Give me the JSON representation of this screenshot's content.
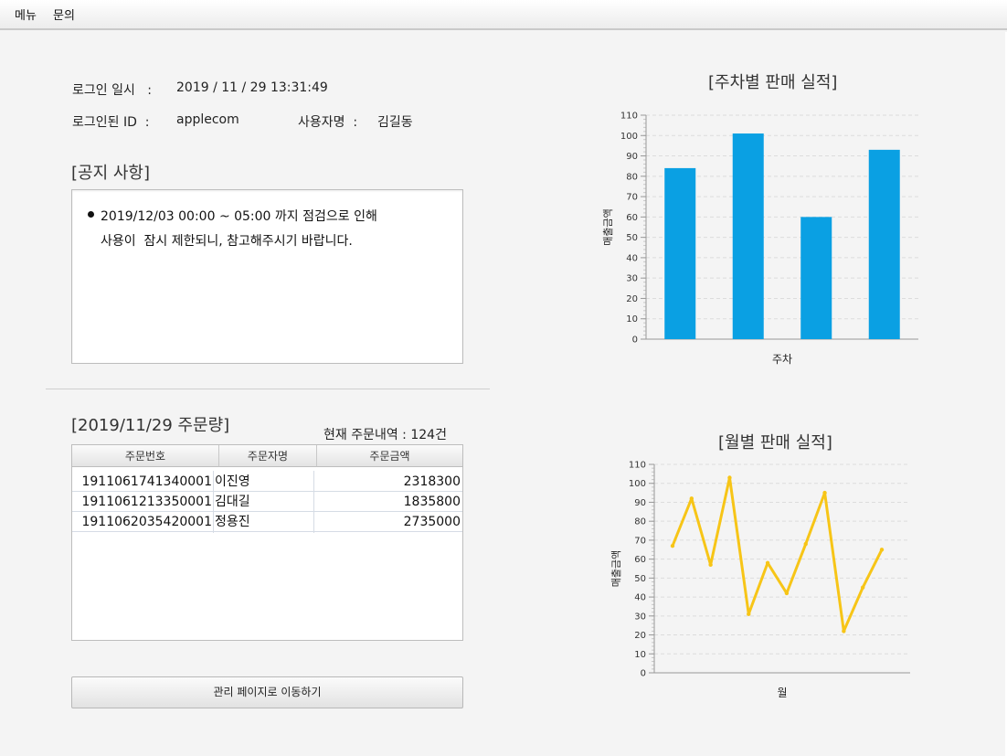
{
  "menu": {
    "items": [
      "메뉴",
      "문의"
    ]
  },
  "login": {
    "time_label": "로그인 일시   :",
    "time_value": "2019 / 11 / 29 13:31:49",
    "id_label": "로그인된 ID  :",
    "id_value": "applecom",
    "user_label": "사용자명  :",
    "user_value": "김길동"
  },
  "notice": {
    "title": "[공지 사항]",
    "lines": [
      "2019/12/03 00:00 ~ 05:00 까지 점검으로 인해",
      "사용이  잠시 제한되니, 참고해주시기 바랍니다."
    ]
  },
  "orders": {
    "title": "[2019/11/29 주문량]",
    "count_text": "현재 주문내역 : 124건",
    "headers": [
      "주문번호",
      "주문자명",
      "주문금액"
    ],
    "rows": [
      [
        "1911061741340001",
        "이진영",
        "2318300"
      ],
      [
        "1911061213350001",
        "김대길",
        "1835800"
      ],
      [
        "1911062035420001",
        "정용진",
        "2735000"
      ]
    ]
  },
  "admin_button": "관리 페이지로 이동하기",
  "chart_data": [
    {
      "type": "bar",
      "title": "[주차별 판매 실적]",
      "xlabel": "주차",
      "ylabel": "매출금액",
      "categories": [
        "",
        "",
        "",
        ""
      ],
      "values": [
        84,
        101,
        60,
        93
      ],
      "ylim": [
        0,
        110
      ],
      "yticks": [
        0,
        10,
        20,
        30,
        40,
        50,
        60,
        70,
        80,
        90,
        100,
        110
      ],
      "grid": true,
      "color": "#0aa0e3"
    },
    {
      "type": "line",
      "title": "[월별 판매 실적]",
      "xlabel": "월",
      "ylabel": "매출금액",
      "x": [
        1,
        2,
        3,
        4,
        5,
        6,
        7,
        8,
        9,
        10,
        11,
        12
      ],
      "values": [
        67,
        92,
        57,
        103,
        31,
        58,
        42,
        68,
        95,
        22,
        45,
        65
      ],
      "ylim": [
        0,
        110
      ],
      "yticks": [
        0,
        10,
        20,
        30,
        40,
        50,
        60,
        70,
        80,
        90,
        100,
        110
      ],
      "grid": true,
      "color": "#f7c517"
    }
  ]
}
